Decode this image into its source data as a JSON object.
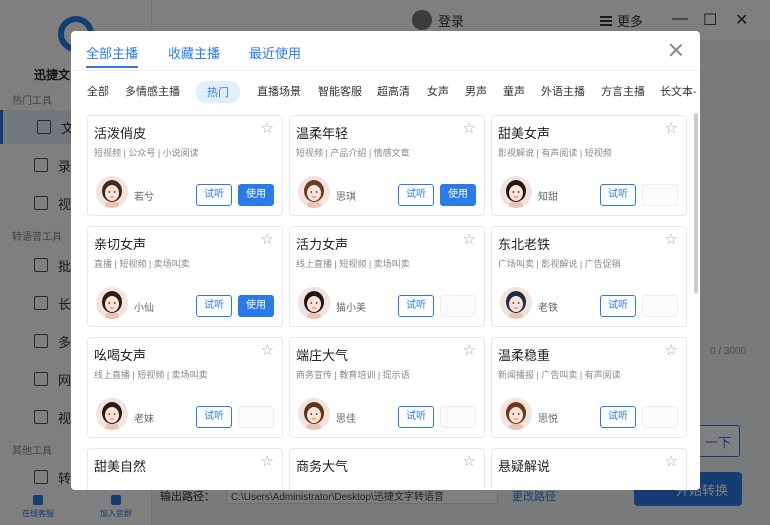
{
  "background_app": {
    "app_name": "迅捷文",
    "sections": {
      "hot_tools": "热门工具",
      "convert_tools": "转语音工具",
      "other_tools": "其他工具"
    },
    "nav": [
      "文",
      "录",
      "视",
      "批",
      "长",
      "多",
      "网",
      "视",
      "转"
    ],
    "footer": [
      "在线客服",
      "加入官群"
    ],
    "login": "登录",
    "more": "更多",
    "window_controls": [
      "—",
      "☐",
      "✕"
    ],
    "char_counter": "0 / 3000",
    "btn_small": "一下",
    "btn_start": "开始转换",
    "output_label": "输出路径：",
    "output_path": "C:\\Users\\Administrator\\Desktop\\迅捷文字转语音",
    "change_path": "更改路径"
  },
  "modal": {
    "tabs": [
      "全部主播",
      "收藏主播",
      "最近使用"
    ],
    "active_tab": 0,
    "categories": [
      "全部",
      "多情感主播",
      "热门",
      "直播场景",
      "智能客服",
      "超高清",
      "女声",
      "男声",
      "童声",
      "外语主播",
      "方言主播",
      "长文本-"
    ],
    "active_category": 2,
    "listen_label": "试听",
    "use_label": "使用",
    "cards": [
      {
        "title": "活泼俏皮",
        "tags": "短视频  |  公众号  |  小说阅读",
        "name": "若兮",
        "use": true,
        "hair": "#3a2a22"
      },
      {
        "title": "温柔年轻",
        "tags": "短视频  |  产品介绍  |  情感文章",
        "name": "思琪",
        "use": true,
        "hair": "#6b3d24"
      },
      {
        "title": "甜美女声",
        "tags": "影视解说  |  有声阅读  |  短视频",
        "name": "知甜",
        "use": false,
        "hair": "#1f1a1a"
      },
      {
        "title": "亲切女声",
        "tags": "直播  |  短视频  |  卖场叫卖",
        "name": "小仙",
        "use": true,
        "hair": "#2a1f1c"
      },
      {
        "title": "活力女声",
        "tags": "线上直播  |  短视频  |  卖场叫卖",
        "name": "猫小美",
        "use": false,
        "hair": "#1c1616"
      },
      {
        "title": "东北老铁",
        "tags": "广场叫卖  |  影视解说  |  广告促销",
        "name": "老铁",
        "use": false,
        "hair": "#1e2a4a"
      },
      {
        "title": "吆喝女声",
        "tags": "线上直播  |  短视频  |  卖场叫卖",
        "name": "老妹",
        "use": false,
        "hair": "#2b1d1d"
      },
      {
        "title": "端庄大气",
        "tags": "商务宣传  |  教育培训  |  提示语",
        "name": "思佳",
        "use": false,
        "hair": "#5a3420"
      },
      {
        "title": "温柔稳重",
        "tags": "新闻播报  |  广告叫卖  |  有声阅读",
        "name": "思悦",
        "use": false,
        "hair": "#6a3a1e"
      },
      {
        "title": "甜美自然",
        "tags": "",
        "name": "",
        "use": false,
        "hair": "#3a2a22"
      },
      {
        "title": "商务大气",
        "tags": "",
        "name": "",
        "use": false,
        "hair": "#3a2a22"
      },
      {
        "title": "悬疑解说",
        "tags": "",
        "name": "",
        "use": false,
        "hair": "#3a2a22"
      }
    ]
  },
  "colors": {
    "accent": "#2a7be8",
    "overlay": "rgba(0,0,0,0.5)"
  }
}
